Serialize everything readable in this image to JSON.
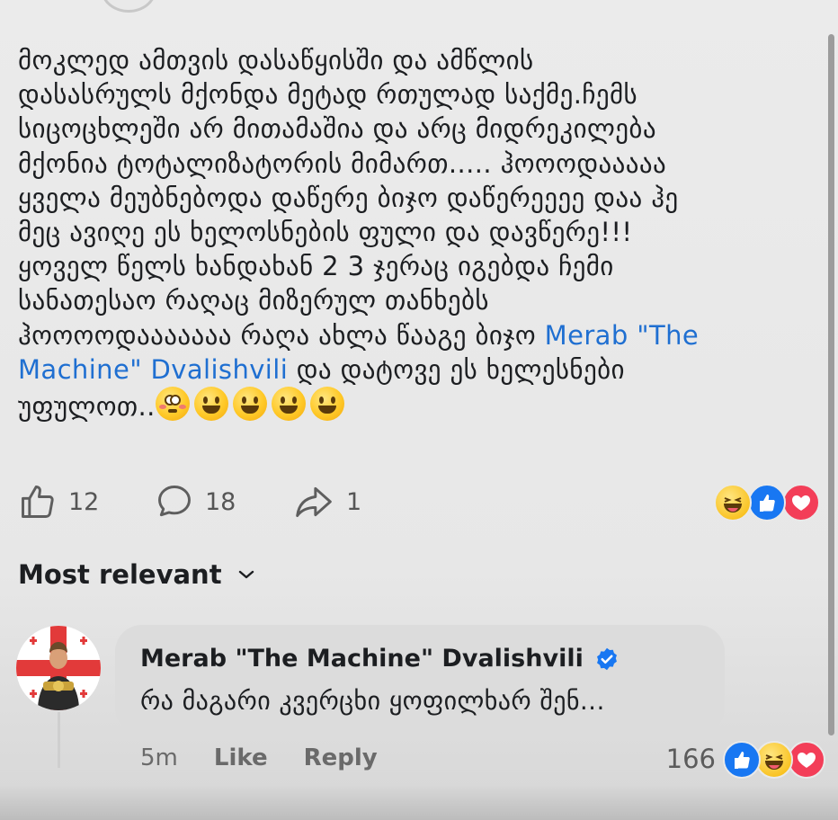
{
  "post": {
    "lines": [
      "მოკლედ ამთვის დასაწყისში და ამწლის",
      "დასასრულს მქონდა მეტად რთულად საქმე.ჩემს",
      "სიცოცხლეში არ მითამაშია და არც მიდრეკილება",
      "მქონია ტოტალიზატორის მიმართ..... ჰოოოდააააა",
      "ყველა მეუბნებოდა დაწერე ბიჯო დაწერეეეე  დაა ჰე",
      "მეც  ავიღე ეს ხელოსნების ფული და დავწერე!!!",
      "ყოველ წელს ხანდახან 2 3 ჯერაც  იგებდა ჩემი",
      "სანათესაო რაღაც მიზერულ თანხებს"
    ],
    "line9_prefix": "ჰოოოოდააააააა რაღა ახლა წააგე ბიჯო ",
    "mention_part1": "Merab \"The",
    "mention_part2": "Machine\" Dvalishvili",
    "line10_suffix": " და დატოვე ეს ხელესნები",
    "line11_text": "უფულოთ..",
    "emojis": [
      "flushed-face-emoji",
      "grinning-face-emoji",
      "grinning-face-emoji",
      "grinning-face-emoji",
      "grinning-face-emoji"
    ]
  },
  "actions": {
    "like_count": "12",
    "comment_count": "18",
    "share_count": "1",
    "reactions": [
      "haha-reaction-icon",
      "like-reaction-icon",
      "love-reaction-icon"
    ]
  },
  "sort": {
    "label": "Most relevant"
  },
  "comment": {
    "author": "Merab \"The Machine\" Dvalishvili",
    "verified": true,
    "text": "რა მაგარი კვერცხი ყოფილხარ შენ...",
    "time": "5m",
    "like_label": "Like",
    "reply_label": "Reply",
    "reaction_count": "166",
    "reactions": [
      "like-reaction-icon",
      "haha-reaction-icon",
      "love-reaction-icon"
    ]
  },
  "colors": {
    "background": "#e9e9e9",
    "mention": "#1f6fd1",
    "like_blue": "#1877f2",
    "love_red": "#f33e58",
    "bubble": "#dcdcdc"
  }
}
